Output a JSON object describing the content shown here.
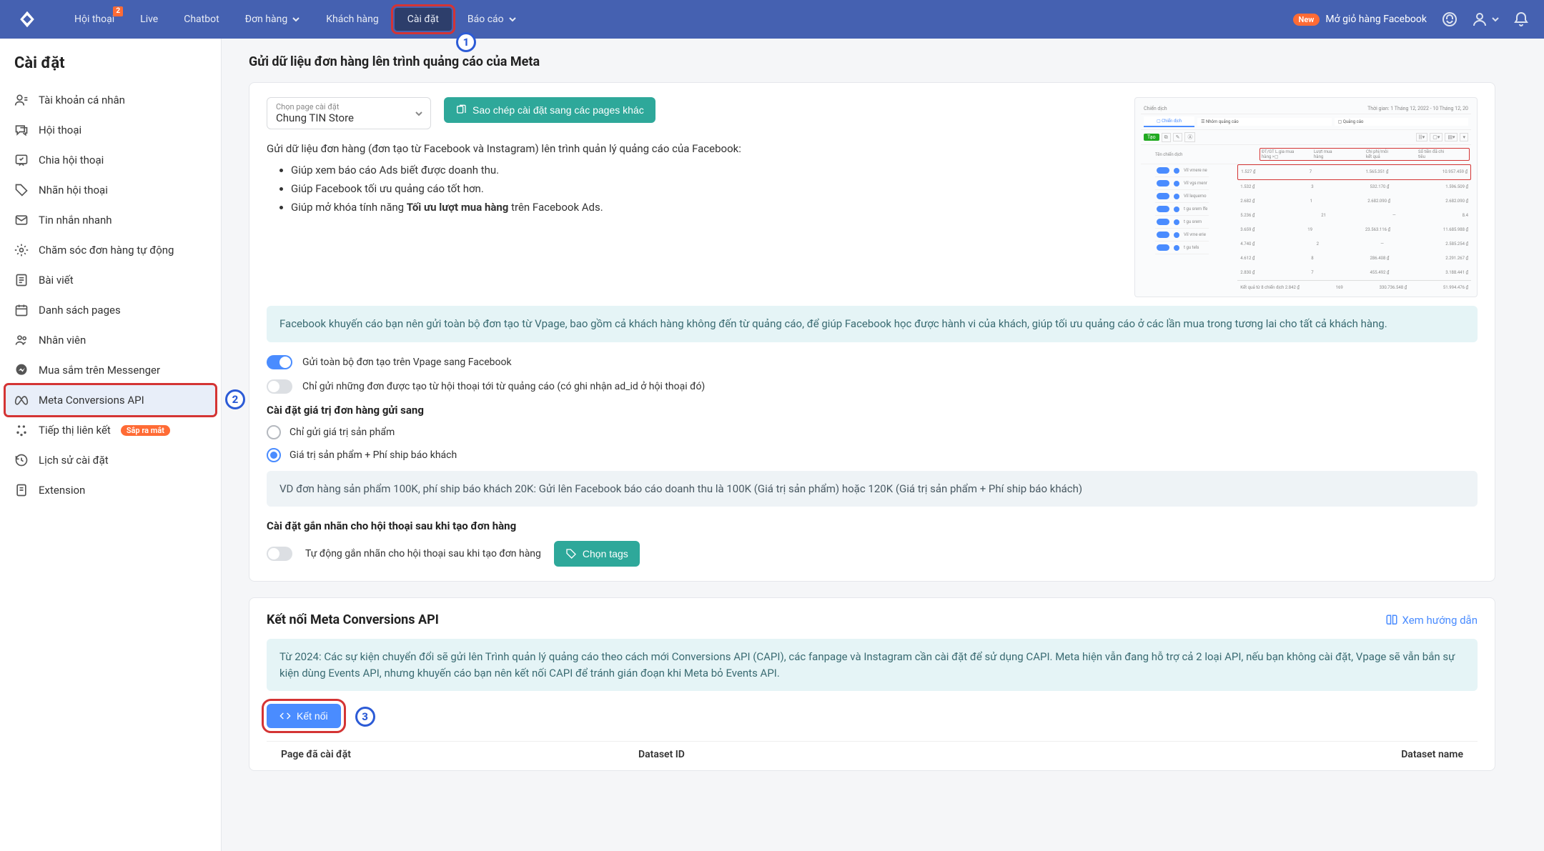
{
  "nav": {
    "items": [
      "Hội thoại",
      "Live",
      "Chatbot",
      "Đơn hàng",
      "Khách hàng",
      "Cài đặt",
      "Báo cáo"
    ],
    "badge_conv": "2",
    "new_tag": "New",
    "fb_cart": "Mở giỏ hàng Facebook"
  },
  "sidebar": {
    "title": "Cài đặt",
    "items": [
      "Tài khoản cá nhân",
      "Hội thoại",
      "Chia hội thoại",
      "Nhãn hội thoại",
      "Tin nhắn nhanh",
      "Chăm sóc đơn hàng tự động",
      "Bài viết",
      "Danh sách pages",
      "Nhân viên",
      "Mua sắm trên Messenger",
      "Meta Conversions API",
      "Tiếp thị liên kết",
      "Lịch sử cài đặt",
      "Extension"
    ],
    "soon": "Sắp ra mắt"
  },
  "main": {
    "title1": "Gửi dữ liệu đơn hàng lên trình quảng cáo của Meta",
    "select_label": "Chọn page cài đặt",
    "select_value": "Chung TIN Store",
    "copy_btn": "Sao chép cài đặt sang các pages khác",
    "desc": "Gửi dữ liệu đơn hàng (đơn tạo từ Facebook và Instagram) lên trình quản lý quảng cáo của Facebook:",
    "pts": [
      "Giúp xem báo cáo Ads biết được doanh thu.",
      "Giúp Facebook tối ưu quảng cáo tốt hơn."
    ],
    "pt3_a": "Giúp mở khóa tính năng ",
    "pt3_b": "Tối ưu lượt mua hàng",
    "pt3_c": " trên Facebook Ads.",
    "info1": "Facebook khuyến cáo bạn nên gửi toàn bộ đơn tạo từ Vpage, bao gồm cả khách hàng không đến từ quảng cáo, để giúp Facebook học được hành vi của khách, giúp tối ưu quảng cáo ở các lần mua trong tương lai cho tất cả khách hàng.",
    "toggle1": "Gửi toàn bộ đơn tạo trên Vpage sang Facebook",
    "toggle2": "Chỉ gửi những đơn được tạo từ hội thoại tới từ quảng cáo (có ghi nhận ad_id ở hội thoại đó)",
    "sub1": "Cài đặt giá trị đơn hàng gửi sang",
    "radio1": "Chỉ gửi giá trị sản phẩm",
    "radio2": "Giá trị sản phẩm + Phí ship báo khách",
    "info2": "VD đơn hàng sản phẩm 100K, phí ship báo khách 20K: Gửi lên Facebook báo cáo doanh thu là 100K (Giá trị sản phẩm) hoặc 120K (Giá trị sản phẩm + Phí ship báo khách)",
    "sub2": "Cài đặt gắn nhãn cho hội thoại sau khi tạo đơn hàng",
    "toggle3": "Tự động gắn nhãn cho hội thoại sau khi tạo đơn hàng",
    "tags_btn": "Chọn tags",
    "title2": "Kết nối Meta Conversions API",
    "guide": "Xem hướng dẫn",
    "info3": "Từ 2024: Các sự kiện chuyển đổi sẽ gửi lên Trình quản lý quảng cáo theo cách mới Conversions API (CAPI), các fanpage và Instagram cần cài đặt để sử dụng CAPI. Meta hiện vẫn đang hỗ trợ cả 2 loại API, nếu bạn không cài đặt, Vpage sẽ vẫn bắn sự kiện dùng Events API, nhưng khuyến cáo bạn nên kết nối CAPI để tránh gián đoạn khi Meta bỏ Events API.",
    "connect_btn": "Kết nối",
    "th1": "Page đã cài đặt",
    "th2": "Dataset ID",
    "th3": "Dataset name"
  },
  "annotations": [
    "1",
    "2",
    "3"
  ]
}
